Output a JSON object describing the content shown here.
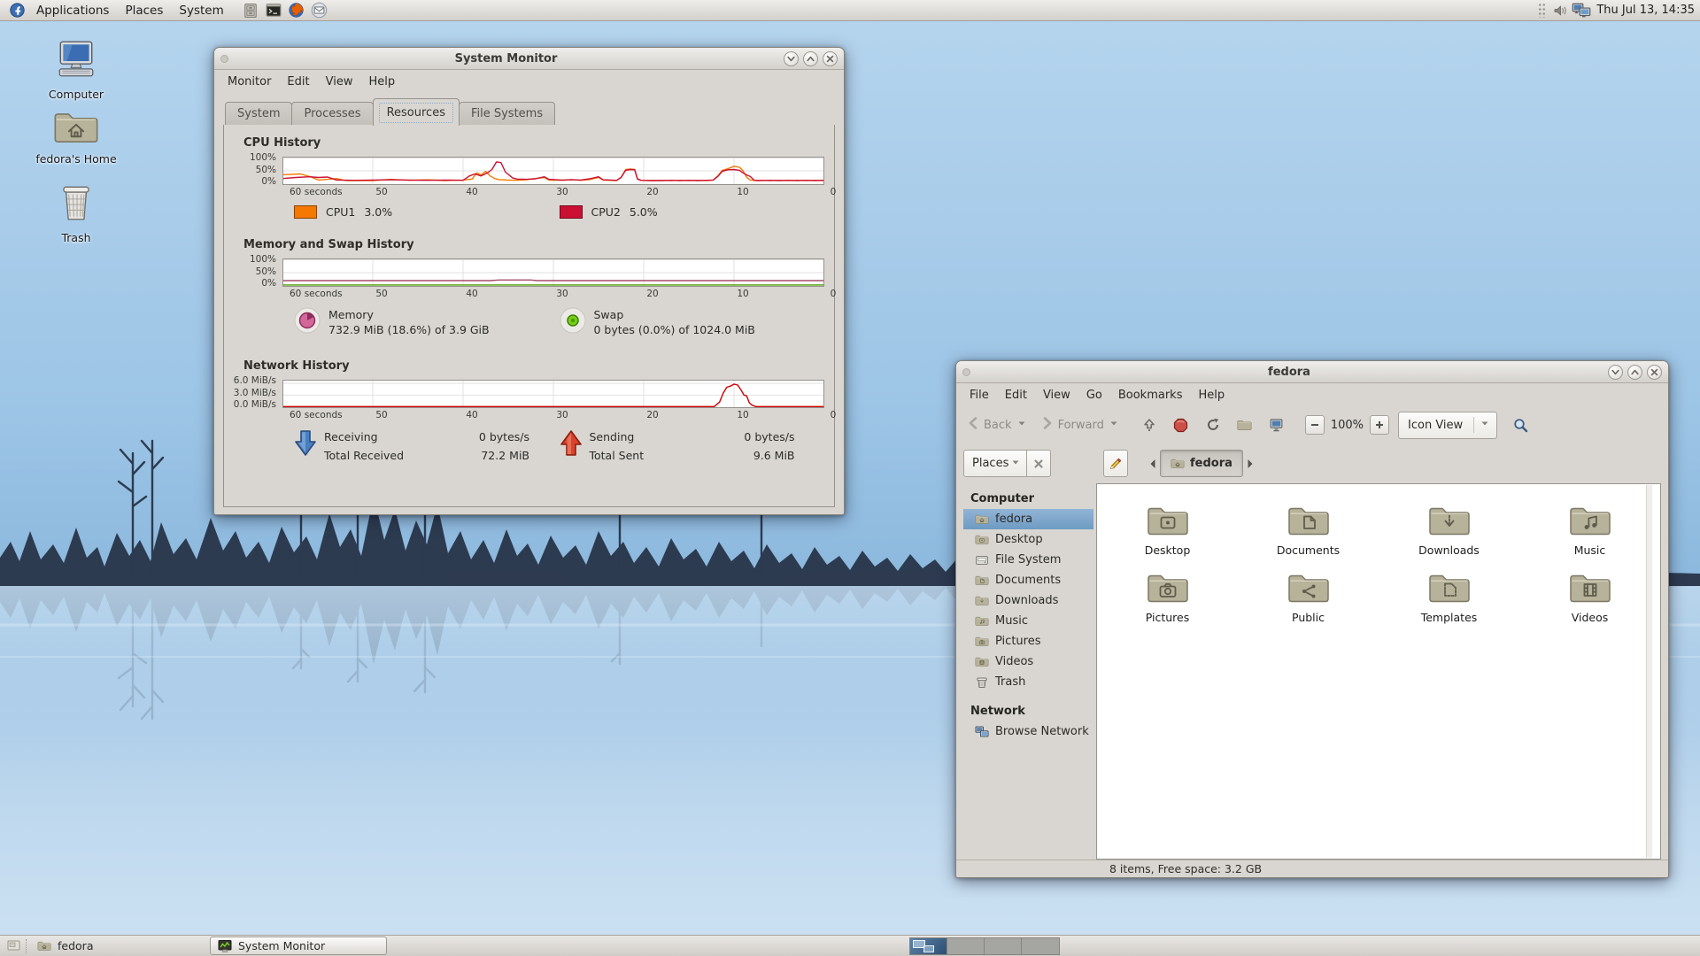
{
  "top_panel": {
    "menus": [
      "Applications",
      "Places",
      "System"
    ],
    "launchers": [
      {
        "name": "file-manager",
        "icon": "file-cabinet"
      },
      {
        "name": "terminal",
        "icon": "terminal"
      },
      {
        "name": "web-browser",
        "icon": "firefox"
      },
      {
        "name": "email",
        "icon": "email"
      }
    ],
    "clock": "Thu Jul 13, 14:35"
  },
  "desktop": {
    "icons": [
      {
        "label": "Computer",
        "icon": "computer-desktop"
      },
      {
        "label": "fedora's Home",
        "icon": "home-desktop"
      },
      {
        "label": "Trash",
        "icon": "trash-desktop"
      }
    ]
  },
  "system_monitor": {
    "title": "System Monitor",
    "menus": [
      "Monitor",
      "Edit",
      "View",
      "Help"
    ],
    "tabs": [
      {
        "label": "System",
        "active": false
      },
      {
        "label": "Processes",
        "active": false
      },
      {
        "label": "Resources",
        "active": true
      },
      {
        "label": "File Systems",
        "active": false
      }
    ],
    "sections": {
      "cpu": {
        "heading": "CPU History",
        "legend": [
          {
            "name": "CPU1",
            "value": "3.0%",
            "color": "#f57900"
          },
          {
            "name": "CPU2",
            "value": "5.0%",
            "color": "#cc1034"
          }
        ]
      },
      "memory": {
        "heading": "Memory and Swap History",
        "legend": [
          {
            "icon": "memory-pie",
            "label": "Memory",
            "value": "732.9 MiB (18.6%) of 3.9 GiB"
          },
          {
            "icon": "swap-dot",
            "label": "Swap",
            "value": "0 bytes (0.0%) of 1024.0 MiB"
          }
        ]
      },
      "network": {
        "heading": "Network History",
        "legend": [
          {
            "icon": "recv-arrow",
            "rows": [
              [
                "Receiving",
                "0 bytes/s"
              ],
              [
                "Total Received",
                "72.2 MiB"
              ]
            ]
          },
          {
            "icon": "send-arrow",
            "rows": [
              [
                "Sending",
                "0 bytes/s"
              ],
              [
                "Total Sent",
                "9.6 MiB"
              ]
            ]
          }
        ]
      }
    }
  },
  "chart_data": [
    {
      "id": "cpu",
      "type": "line",
      "title": "CPU History",
      "x_range": [
        60,
        0
      ],
      "x_ticks": [
        "60 seconds",
        "50",
        "40",
        "30",
        "20",
        "10",
        "0"
      ],
      "y_ticks": [
        "100%",
        "50%",
        "0%"
      ],
      "ylim": [
        0,
        100
      ],
      "y_grid": [
        100,
        50
      ],
      "series": [
        {
          "name": "CPU1",
          "color": "#f57900",
          "current": "3.0%",
          "points": [
            [
              60,
              35
            ],
            [
              58,
              38
            ],
            [
              57,
              28
            ],
            [
              56,
              14
            ],
            [
              54,
              20
            ],
            [
              53,
              12
            ],
            [
              50,
              12
            ],
            [
              48,
              17
            ],
            [
              46,
              13
            ],
            [
              44,
              15
            ],
            [
              42,
              12
            ],
            [
              40,
              14
            ],
            [
              39,
              18
            ],
            [
              38.5,
              42
            ],
            [
              38,
              34
            ],
            [
              37.5,
              48
            ],
            [
              37,
              30
            ],
            [
              36.5,
              20
            ],
            [
              36,
              16
            ],
            [
              35,
              14
            ],
            [
              34,
              13
            ],
            [
              33,
              15
            ],
            [
              32,
              20
            ],
            [
              31,
              24
            ],
            [
              30.5,
              14
            ],
            [
              29,
              13
            ],
            [
              28,
              15
            ],
            [
              27,
              13
            ],
            [
              26,
              16
            ],
            [
              25,
              24
            ],
            [
              24.5,
              14
            ],
            [
              23,
              12
            ],
            [
              22.5,
              25
            ],
            [
              22,
              55
            ],
            [
              21.5,
              57
            ],
            [
              21,
              56
            ],
            [
              20.7,
              20
            ],
            [
              20.3,
              13
            ],
            [
              19,
              12
            ],
            [
              18,
              13
            ],
            [
              17,
              12
            ],
            [
              16,
              13
            ],
            [
              15,
              12
            ],
            [
              14,
              13
            ],
            [
              13,
              12
            ],
            [
              12.3,
              14
            ],
            [
              11.8,
              30
            ],
            [
              11.3,
              52
            ],
            [
              10.7,
              58
            ],
            [
              10,
              68
            ],
            [
              9.4,
              64
            ],
            [
              9,
              50
            ],
            [
              8.6,
              25
            ],
            [
              8.2,
              14
            ],
            [
              7.5,
              12
            ],
            [
              7,
              13
            ],
            [
              6,
              12
            ],
            [
              5,
              13
            ],
            [
              4,
              12
            ],
            [
              3,
              13
            ],
            [
              2,
              12
            ],
            [
              1,
              13
            ],
            [
              0,
              12
            ]
          ]
        },
        {
          "name": "CPU2",
          "color": "#cc1034",
          "current": "5.0%",
          "points": [
            [
              60,
              20
            ],
            [
              58.5,
              24
            ],
            [
              57,
              27
            ],
            [
              56,
              24
            ],
            [
              55,
              26
            ],
            [
              54,
              14
            ],
            [
              52,
              13
            ],
            [
              50,
              14
            ],
            [
              48,
              15
            ],
            [
              46,
              14
            ],
            [
              44,
              13
            ],
            [
              42,
              14
            ],
            [
              40,
              13
            ],
            [
              39.3,
              30
            ],
            [
              38.7,
              38
            ],
            [
              38,
              30
            ],
            [
              37.3,
              42
            ],
            [
              36.8,
              55
            ],
            [
              36.3,
              85
            ],
            [
              35.8,
              82
            ],
            [
              35.3,
              45
            ],
            [
              34.5,
              22
            ],
            [
              34,
              18
            ],
            [
              33,
              17
            ],
            [
              32,
              19
            ],
            [
              31,
              27
            ],
            [
              30.5,
              17
            ],
            [
              29,
              14
            ],
            [
              28,
              16
            ],
            [
              27,
              14
            ],
            [
              26,
              19
            ],
            [
              25,
              27
            ],
            [
              24.5,
              15
            ],
            [
              23,
              13
            ],
            [
              22.5,
              24
            ],
            [
              22,
              52
            ],
            [
              21.5,
              55
            ],
            [
              21,
              54
            ],
            [
              20.7,
              18
            ],
            [
              20.3,
              13
            ],
            [
              19,
              12
            ],
            [
              18,
              12
            ],
            [
              17,
              13
            ],
            [
              16,
              12
            ],
            [
              15,
              13
            ],
            [
              14,
              12
            ],
            [
              13,
              13
            ],
            [
              12.3,
              14
            ],
            [
              11.8,
              28
            ],
            [
              11.3,
              48
            ],
            [
              10.7,
              54
            ],
            [
              10,
              55
            ],
            [
              9.4,
              52
            ],
            [
              9,
              42
            ],
            [
              8.6,
              34
            ],
            [
              8.2,
              28
            ],
            [
              7.8,
              14
            ],
            [
              7.3,
              12
            ],
            [
              6,
              13
            ],
            [
              5,
              12
            ],
            [
              4,
              13
            ],
            [
              3,
              12
            ],
            [
              2,
              13
            ],
            [
              1,
              12
            ],
            [
              0,
              13
            ]
          ]
        }
      ]
    },
    {
      "id": "memory",
      "type": "line",
      "title": "Memory and Swap History",
      "x_range": [
        60,
        0
      ],
      "x_ticks": [
        "60 seconds",
        "50",
        "40",
        "30",
        "20",
        "10",
        "0"
      ],
      "y_ticks": [
        "100%",
        "50%",
        "0%"
      ],
      "ylim": [
        0,
        100
      ],
      "y_grid": [
        100,
        50
      ],
      "series": [
        {
          "name": "Memory",
          "color": "#a84a68",
          "current": "18.6%",
          "points": [
            [
              60,
              19
            ],
            [
              37,
              19
            ],
            [
              36,
              21.5
            ],
            [
              32.5,
              21.5
            ],
            [
              31.8,
              19
            ],
            [
              0,
              19
            ]
          ]
        },
        {
          "name": "Swap",
          "color": "#4e9a06",
          "current": "0.0%",
          "points": [
            [
              60,
              2
            ],
            [
              0,
              2
            ]
          ]
        }
      ]
    },
    {
      "id": "network",
      "type": "line",
      "title": "Network History",
      "x_range": [
        60,
        0
      ],
      "x_ticks": [
        "60 seconds",
        "50",
        "40",
        "30",
        "20",
        "10",
        "0"
      ],
      "y_ticks": [
        "6.0 MiB/s",
        "3.0 MiB/s",
        "0.0 MiB/s"
      ],
      "ylim": [
        0,
        6.6
      ],
      "y_grid": [
        6,
        3
      ],
      "series": [
        {
          "name": "Sending",
          "color": "#cc0000",
          "current": "0 bytes/s",
          "points": [
            [
              60,
              0.05
            ],
            [
              12.2,
              0.05
            ],
            [
              11.6,
              1.2
            ],
            [
              11.2,
              3.5
            ],
            [
              10.8,
              5.0
            ],
            [
              10.4,
              5.3
            ],
            [
              10,
              5.8
            ],
            [
              9.6,
              5.6
            ],
            [
              9.2,
              4.2
            ],
            [
              8.9,
              3.0
            ],
            [
              8.6,
              2.8
            ],
            [
              8.3,
              1.0
            ],
            [
              8,
              0.4
            ],
            [
              7.6,
              0.05
            ],
            [
              0,
              0.05
            ]
          ]
        }
      ]
    }
  ],
  "file_manager": {
    "title": "fedora",
    "menus": [
      "File",
      "Edit",
      "View",
      "Go",
      "Bookmarks",
      "Help"
    ],
    "toolbar": {
      "back": "Back",
      "forward": "Forward",
      "zoom_level": "100%",
      "view_mode": "Icon View"
    },
    "location": {
      "places": "Places",
      "breadcrumb": "fedora"
    },
    "sidebar": {
      "computer_heading": "Computer",
      "items": [
        {
          "label": "fedora",
          "icon": "folder:home",
          "selected": true
        },
        {
          "label": "Desktop",
          "icon": "folder:desktop"
        },
        {
          "label": "File System",
          "icon": "drive"
        },
        {
          "label": "Documents",
          "icon": "folder:documents"
        },
        {
          "label": "Downloads",
          "icon": "folder:downloads"
        },
        {
          "label": "Music",
          "icon": "folder:music"
        },
        {
          "label": "Pictures",
          "icon": "folder:pictures"
        },
        {
          "label": "Videos",
          "icon": "folder:videos"
        },
        {
          "label": "Trash",
          "icon": "trash"
        }
      ],
      "network_heading": "Network",
      "network_items": [
        {
          "label": "Browse Network",
          "icon": "network"
        }
      ]
    },
    "files": [
      {
        "label": "Desktop",
        "icon": "folder:desktop"
      },
      {
        "label": "Documents",
        "icon": "folder:documents"
      },
      {
        "label": "Downloads",
        "icon": "folder:downloads"
      },
      {
        "label": "Music",
        "icon": "folder:music"
      },
      {
        "label": "Pictures",
        "icon": "folder:pictures"
      },
      {
        "label": "Public",
        "icon": "folder:public"
      },
      {
        "label": "Templates",
        "icon": "folder:templates"
      },
      {
        "label": "Videos",
        "icon": "folder:videos"
      }
    ],
    "status": "8 items, Free space: 3.2 GB"
  },
  "taskbar": {
    "items": [
      {
        "label": "fedora",
        "icon": "folder:home",
        "active": false
      },
      {
        "label": "System Monitor",
        "icon": "sysmon",
        "active": true
      }
    ],
    "workspaces": {
      "count": 4,
      "active": 0
    }
  }
}
